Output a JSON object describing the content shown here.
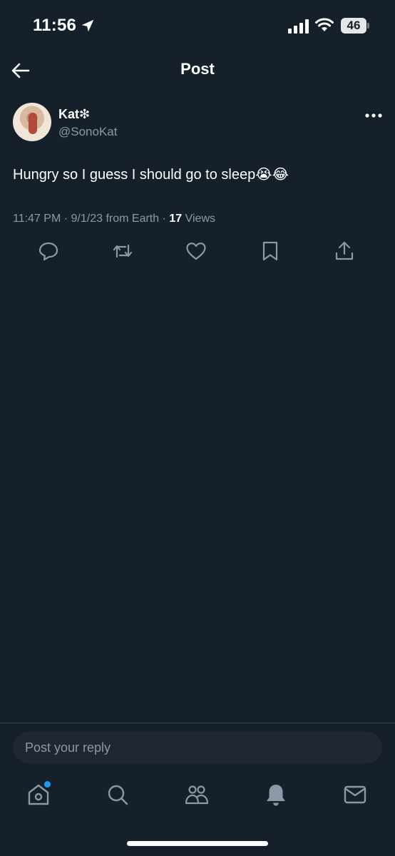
{
  "status_bar": {
    "time": "11:56",
    "battery": "46"
  },
  "header": {
    "title": "Post"
  },
  "post": {
    "display_name": "Kat❇︎",
    "handle": "@SonoKat",
    "text": "Hungry so I guess I should go to sleep😭😂",
    "time": "11:47 PM · 9/1/23 from Earth · ",
    "views_count": "17",
    "views_label": " Views"
  },
  "reply": {
    "placeholder": "Post your reply"
  },
  "icons": {
    "back": "arrow-left-icon",
    "more": "more-horizontal-icon",
    "reply": "comment-icon",
    "repost": "repost-icon",
    "like": "heart-icon",
    "bookmark": "bookmark-icon",
    "share": "share-icon",
    "home": "home-icon",
    "search": "search-icon",
    "communities": "communities-icon",
    "notifications": "bell-icon",
    "messages": "mail-icon"
  },
  "colors": {
    "background": "#15202b",
    "secondary_text": "#8b98a5",
    "accent": "#1d9bf0"
  }
}
